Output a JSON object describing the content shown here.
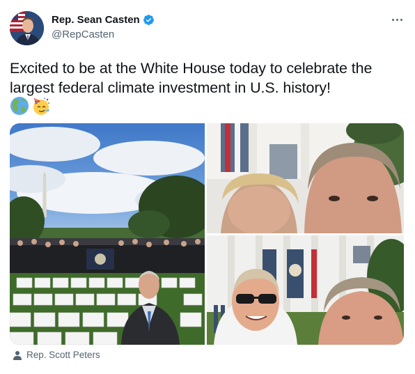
{
  "tweet": {
    "author_name": "Rep. Sean Casten",
    "author_handle": "@RepCasten",
    "text": "Excited to be at the White House today to celebrate the largest federal climate investment in U.S. history!",
    "emojis": [
      "globe-americas",
      "partying-face"
    ],
    "verified": true
  },
  "media": {
    "photos": [
      {
        "description": "south-lawn-crowd",
        "position": "left"
      },
      {
        "description": "selfie-top",
        "position": "top-right"
      },
      {
        "description": "selfie-bottom",
        "position": "bottom-right"
      }
    ]
  },
  "tagged": {
    "label": "Rep. Scott Peters"
  },
  "colors": {
    "text": "#0f1419",
    "secondary": "#536471",
    "verified": "#1d9bf0"
  }
}
